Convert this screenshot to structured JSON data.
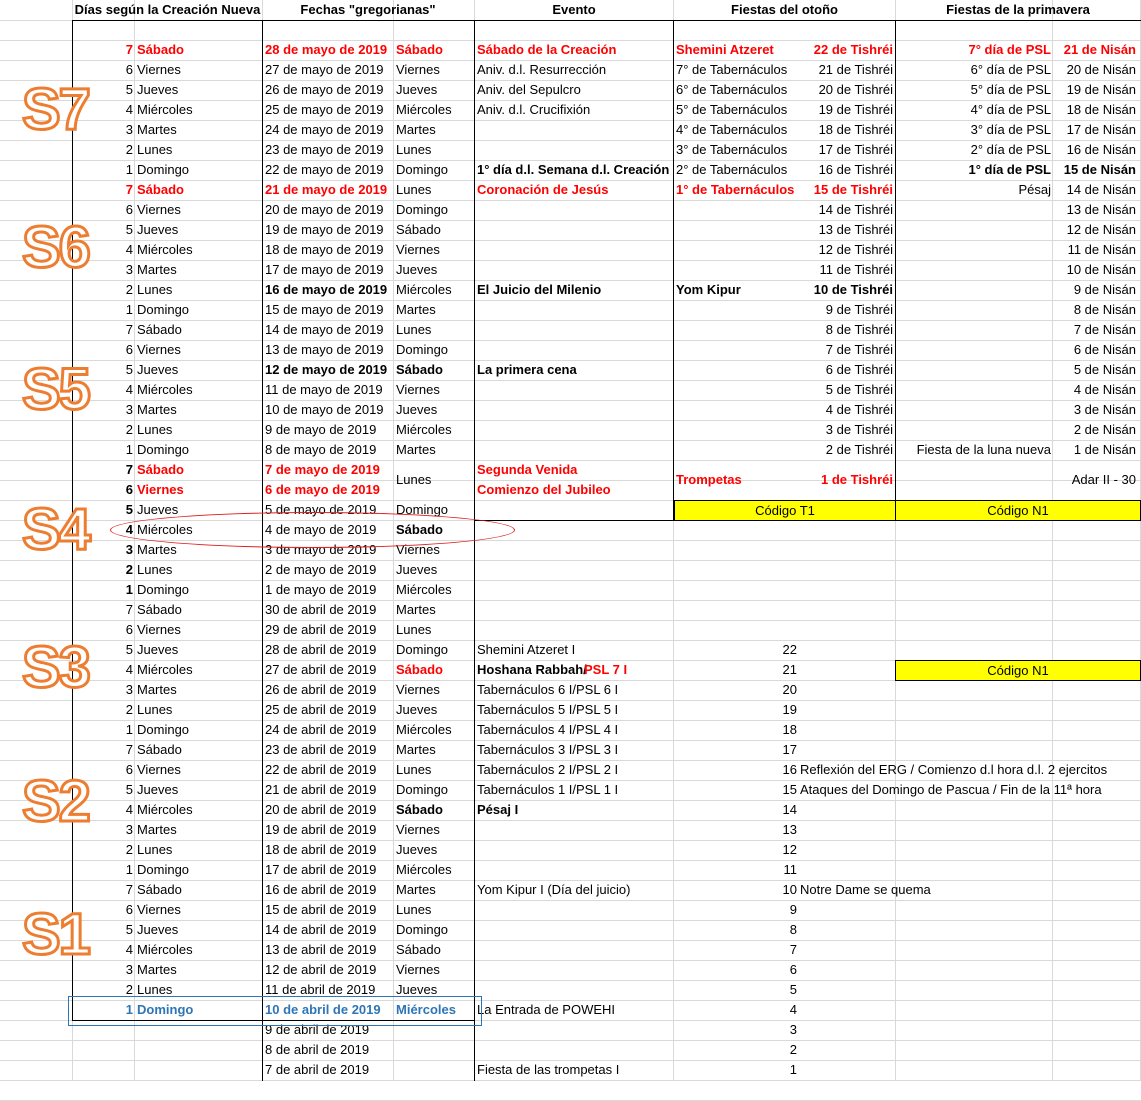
{
  "headers": {
    "a": "Días según la Creación Nueva",
    "b": "Fechas \"gregorianas\"",
    "c": "Evento",
    "d": "Fiestas del otoño",
    "e": "Fiestas de la primavera"
  },
  "week_labels": [
    "S7",
    "S6",
    "S5",
    "S4",
    "S3",
    "S2",
    "S1"
  ],
  "codes": {
    "t1": "Código T1",
    "n1": "Código N1",
    "n1b": "Código N1"
  },
  "rows": [
    [
      "7",
      "Sábado",
      "28 de mayo de 2019",
      "Sábado",
      "Sábado de la Creación",
      "Shemini Atzeret",
      "22 de Tishréi",
      "7° día de PSL",
      "21 de Nisán"
    ],
    [
      "6",
      "Viernes",
      "27 de mayo de 2019",
      "Viernes",
      "Aniv. d.l. Resurrección",
      "7° de Tabernáculos",
      "21 de Tishréi",
      "6° día de PSL",
      "20 de Nisán"
    ],
    [
      "5",
      "Jueves",
      "26 de mayo de 2019",
      "Jueves",
      "Aniv. del Sepulcro",
      "6° de Tabernáculos",
      "20 de Tishréi",
      "5° día de PSL",
      "19 de Nisán"
    ],
    [
      "4",
      "Miércoles",
      "25 de mayo de 2019",
      "Miércoles",
      "Aniv. d.l. Crucifixión",
      "5° de Tabernáculos",
      "19 de Tishréi",
      "4° día de PSL",
      "18 de Nisán"
    ],
    [
      "3",
      "Martes",
      "24 de mayo de 2019",
      "Martes",
      "",
      "4° de Tabernáculos",
      "18 de Tishréi",
      "3° día de PSL",
      "17 de Nisán"
    ],
    [
      "2",
      "Lunes",
      "23 de mayo de 2019",
      "Lunes",
      "",
      "3° de Tabernáculos",
      "17 de Tishréi",
      "2° día de PSL",
      "16 de Nisán"
    ],
    [
      "1",
      "Domingo",
      "22 de mayo de 2019",
      "Domingo",
      "1° día d.l. Semana d.l. Creación",
      "2° de Tabernáculos",
      "16 de Tishréi",
      "1° día de PSL",
      "15 de Nisán"
    ],
    [
      "7",
      "Sábado",
      "21 de mayo de 2019",
      "Lunes",
      "Coronación de Jesús",
      "1° de Tabernáculos",
      "15 de Tishréi",
      "Pésaj",
      "14 de Nisán"
    ],
    [
      "6",
      "Viernes",
      "20 de mayo de 2019",
      "Domingo",
      "",
      "",
      "14 de Tishréi",
      "",
      "13 de Nisán"
    ],
    [
      "5",
      "Jueves",
      "19 de mayo de 2019",
      "Sábado",
      "",
      "",
      "13 de Tishréi",
      "",
      "12 de Nisán"
    ],
    [
      "4",
      "Miércoles",
      "18 de mayo de 2019",
      "Viernes",
      "",
      "",
      "12 de Tishréi",
      "",
      "11 de Nisán"
    ],
    [
      "3",
      "Martes",
      "17 de mayo de 2019",
      "Jueves",
      "",
      "",
      "11 de Tishréi",
      "",
      "10 de Nisán"
    ],
    [
      "2",
      "Lunes",
      "16 de mayo de 2019",
      "Miércoles",
      "El Juicio del Milenio",
      "Yom Kipur",
      "10 de Tishréi",
      "",
      "9 de Nisán"
    ],
    [
      "1",
      "Domingo",
      "15 de mayo de 2019",
      "Martes",
      "",
      "",
      "9 de Tishréi",
      "",
      "8 de Nisán"
    ],
    [
      "7",
      "Sábado",
      "14 de mayo de 2019",
      "Lunes",
      "",
      "",
      "8 de Tishréi",
      "",
      "7 de Nisán"
    ],
    [
      "6",
      "Viernes",
      "13 de mayo de 2019",
      "Domingo",
      "",
      "",
      "7 de Tishréi",
      "",
      "6 de Nisán"
    ],
    [
      "5",
      "Jueves",
      "12 de mayo de 2019",
      "Sábado",
      "La primera cena",
      "",
      "6 de Tishréi",
      "",
      "5 de Nisán"
    ],
    [
      "4",
      "Miércoles",
      "11 de mayo de 2019",
      "Viernes",
      "",
      "",
      "5 de Tishréi",
      "",
      "4 de Nisán"
    ],
    [
      "3",
      "Martes",
      "10 de mayo de 2019",
      "Jueves",
      "",
      "",
      "4 de Tishréi",
      "",
      "3 de Nisán"
    ],
    [
      "2",
      "Lunes",
      "9 de mayo de 2019",
      "Miércoles",
      "",
      "",
      "3 de Tishréi",
      "",
      "2 de Nisán"
    ],
    [
      "1",
      "Domingo",
      "8 de mayo de 2019",
      "Martes",
      "",
      "",
      "2 de Tishréi",
      "Fiesta de la luna nueva",
      "1 de Nisán"
    ],
    [
      "7",
      "Sábado",
      "7 de mayo de 2019",
      "Lunes",
      "Segunda Venida",
      "Trompetas",
      "1 de Tishréi",
      "",
      "Adar II - 30"
    ],
    [
      "6",
      "Viernes",
      "6 de mayo de 2019",
      "",
      "Comienzo del Jubileo",
      "",
      "",
      "",
      ""
    ],
    [
      "5",
      "Jueves",
      "5 de mayo de 2019",
      "Domingo",
      "",
      "",
      "",
      "",
      ""
    ],
    [
      "4",
      "Miércoles",
      "4 de mayo de 2019",
      "Sábado",
      "",
      "",
      "",
      "",
      ""
    ],
    [
      "3",
      "Martes",
      "3 de mayo de 2019",
      "Viernes",
      "",
      "",
      "",
      "",
      ""
    ],
    [
      "2",
      "Lunes",
      "2 de mayo de 2019",
      "Jueves",
      "",
      "",
      "",
      "",
      ""
    ],
    [
      "1",
      "Domingo",
      "1 de mayo de 2019",
      "Miércoles",
      "",
      "",
      "",
      "",
      ""
    ],
    [
      "7",
      "Sábado",
      "30 de abril de 2019",
      "Martes",
      "",
      "",
      "",
      "",
      ""
    ],
    [
      "6",
      "Viernes",
      "29 de abril de 2019",
      "Lunes",
      "",
      "",
      "",
      "",
      ""
    ],
    [
      "5",
      "Jueves",
      "28 de abril de 2019",
      "Domingo",
      "Shemini Atzeret I",
      "",
      "22",
      "",
      ""
    ],
    [
      "4",
      "Miércoles",
      "27 de abril de 2019",
      "Sábado",
      "Hoshana Rabbah/",
      "",
      "21",
      "",
      ""
    ],
    [
      "3",
      "Martes",
      "26 de abril de 2019",
      "Viernes",
      "Tabernáculos 6 I/PSL 6 I",
      "",
      "20",
      "",
      ""
    ],
    [
      "2",
      "Lunes",
      "25 de abril de 2019",
      "Jueves",
      "Tabernáculos 5 I/PSL 5 I",
      "",
      "19",
      "",
      ""
    ],
    [
      "1",
      "Domingo",
      "24 de abril de 2019",
      "Miércoles",
      "Tabernáculos 4 I/PSL 4 I",
      "",
      "18",
      "",
      ""
    ],
    [
      "7",
      "Sábado",
      "23 de abril de 2019",
      "Martes",
      "Tabernáculos 3 I/PSL 3 I",
      "",
      "17",
      "",
      ""
    ],
    [
      "6",
      "Viernes",
      "22 de abril de 2019",
      "Lunes",
      "Tabernáculos 2 I/PSL 2 I",
      "",
      "16",
      "Reflexión del ERG  / Comienzo d.l hora d.l. 2 ejercitos",
      ""
    ],
    [
      "5",
      "Jueves",
      "21 de abril de 2019",
      "Domingo",
      "Tabernáculos 1 I/PSL 1 I",
      "",
      "15",
      "Ataques del Domingo de Pascua / Fin de la 11ª hora",
      ""
    ],
    [
      "4",
      "Miércoles",
      "20 de abril de 2019",
      "Sábado",
      "Pésaj I",
      "",
      "14",
      "",
      ""
    ],
    [
      "3",
      "Martes",
      "19 de abril de 2019",
      "Viernes",
      "",
      "",
      "13",
      "",
      ""
    ],
    [
      "2",
      "Lunes",
      "18 de abril de 2019",
      "Jueves",
      "",
      "",
      "12",
      "",
      ""
    ],
    [
      "1",
      "Domingo",
      "17 de abril de 2019",
      "Miércoles",
      "",
      "",
      "11",
      "",
      ""
    ],
    [
      "7",
      "Sábado",
      "16 de abril de 2019",
      "Martes",
      "Yom Kipur I (Día del juicio)",
      "",
      "10",
      "Notre Dame se quema",
      ""
    ],
    [
      "6",
      "Viernes",
      "15 de abril de 2019",
      "Lunes",
      "",
      "",
      "9",
      "",
      ""
    ],
    [
      "5",
      "Jueves",
      "14 de abril de 2019",
      "Domingo",
      "",
      "",
      "8",
      "",
      ""
    ],
    [
      "4",
      "Miércoles",
      "13 de abril de 2019",
      "Sábado",
      "",
      "",
      "7",
      "",
      ""
    ],
    [
      "3",
      "Martes",
      "12 de abril de 2019",
      "Viernes",
      "",
      "",
      "6",
      "",
      ""
    ],
    [
      "2",
      "Lunes",
      "11 de abril de 2019",
      "Jueves",
      "",
      "",
      "5",
      "",
      ""
    ],
    [
      "1",
      "Domingo",
      "10 de abril de 2019",
      "Miércoles",
      "La Entrada de POWEHI",
      "",
      "4",
      "",
      ""
    ],
    [
      "",
      "",
      "9 de abril de 2019",
      "",
      "",
      "",
      "3",
      "",
      ""
    ],
    [
      "",
      "",
      "8 de abril de 2019",
      "",
      "",
      "",
      "2",
      "",
      ""
    ],
    [
      "",
      "",
      "7 de abril de 2019",
      "",
      "Fiesta de las trompetas I",
      "",
      "1",
      "",
      ""
    ]
  ],
  "extra": {
    "psl7": "PSL 7 I"
  },
  "colors": {
    "red": "#ff0000",
    "blue": "#2e75b6",
    "orange": "#ed7d31",
    "yellow": "#ffff00"
  }
}
